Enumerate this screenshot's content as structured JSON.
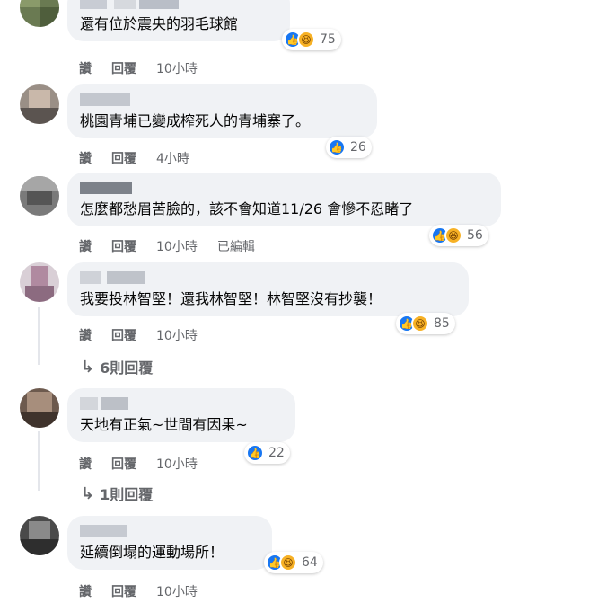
{
  "actions": {
    "like": "讚",
    "reply": "回覆",
    "edited": "已編輯"
  },
  "comments": [
    {
      "text": "還有位於震央的羽毛球館",
      "time": "10小時",
      "reactions": "75",
      "has_haha": true
    },
    {
      "text": "桃園青埔已變成榨死人的青埔寨了。",
      "time": "4小時",
      "reactions": "26",
      "has_haha": false
    },
    {
      "text": "怎麼都愁眉苦臉的，該不會知道11/26 會慘不忍睹了",
      "time": "10小時",
      "reactions": "56",
      "has_haha": true,
      "edited": true
    },
    {
      "text": "我要投林智堅！還我林智堅！林智堅沒有抄襲！",
      "time": "10小時",
      "reactions": "85",
      "has_haha": true,
      "replies": "6則回覆"
    },
    {
      "text": "天地有正氣~世間有因果~",
      "time": "10小時",
      "reactions": "22",
      "has_haha": false,
      "replies": "1則回覆"
    },
    {
      "text": "延續倒塌的運動場所！",
      "time": "10小時",
      "reactions": "64",
      "has_haha": true
    }
  ],
  "colors": {
    "bubble": "#f0f2f5",
    "like": "#1877f2",
    "haha": "#f7b125",
    "meta": "#65676b"
  },
  "icons": {
    "like": "thumbs-up-icon",
    "haha": "laughing-face-icon",
    "reply_arrow": "reply-arrow-icon"
  }
}
